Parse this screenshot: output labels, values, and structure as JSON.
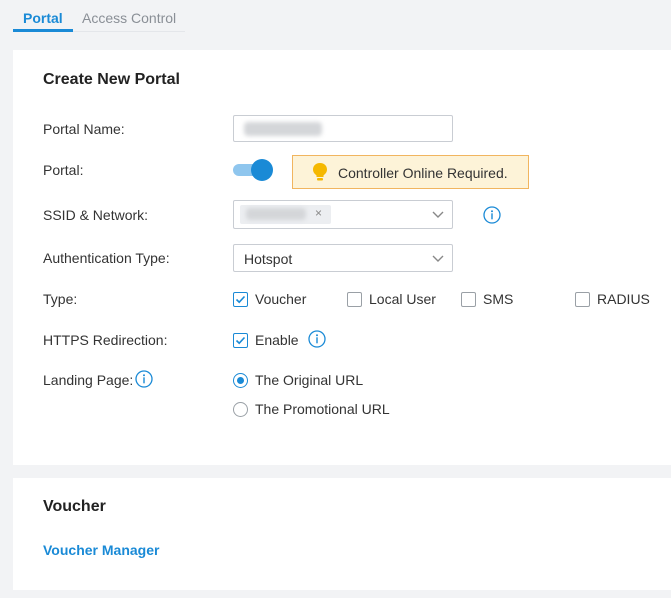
{
  "tabs": [
    {
      "label": "Portal",
      "active": true
    },
    {
      "label": "Access Control",
      "active": false
    }
  ],
  "create_portal": {
    "title": "Create New Portal",
    "portal_name": {
      "label": "Portal Name:"
    },
    "portal": {
      "label": "Portal:",
      "enabled": true,
      "warning": "Controller Online Required."
    },
    "ssid": {
      "label": "SSID & Network:",
      "tag_remove": "×"
    },
    "auth_type": {
      "label": "Authentication Type:",
      "value": "Hotspot"
    },
    "type": {
      "label": "Type:",
      "options": [
        {
          "label": "Voucher",
          "checked": true
        },
        {
          "label": "Local User",
          "checked": false
        },
        {
          "label": "SMS",
          "checked": false
        },
        {
          "label": "RADIUS",
          "checked": false
        }
      ]
    },
    "https": {
      "label": "HTTPS Redirection:",
      "option": "Enable",
      "checked": true
    },
    "landing": {
      "label": "Landing Page:",
      "options": [
        {
          "label": "The Original URL",
          "selected": true
        },
        {
          "label": "The Promotional URL",
          "selected": false
        }
      ]
    }
  },
  "voucher": {
    "title": "Voucher",
    "link": "Voucher Manager"
  },
  "colors": {
    "accent": "#1a8ad6",
    "warning_bg": "#fdf3d8",
    "warning_border": "#f1b55f",
    "bulb": "#f5b800"
  }
}
